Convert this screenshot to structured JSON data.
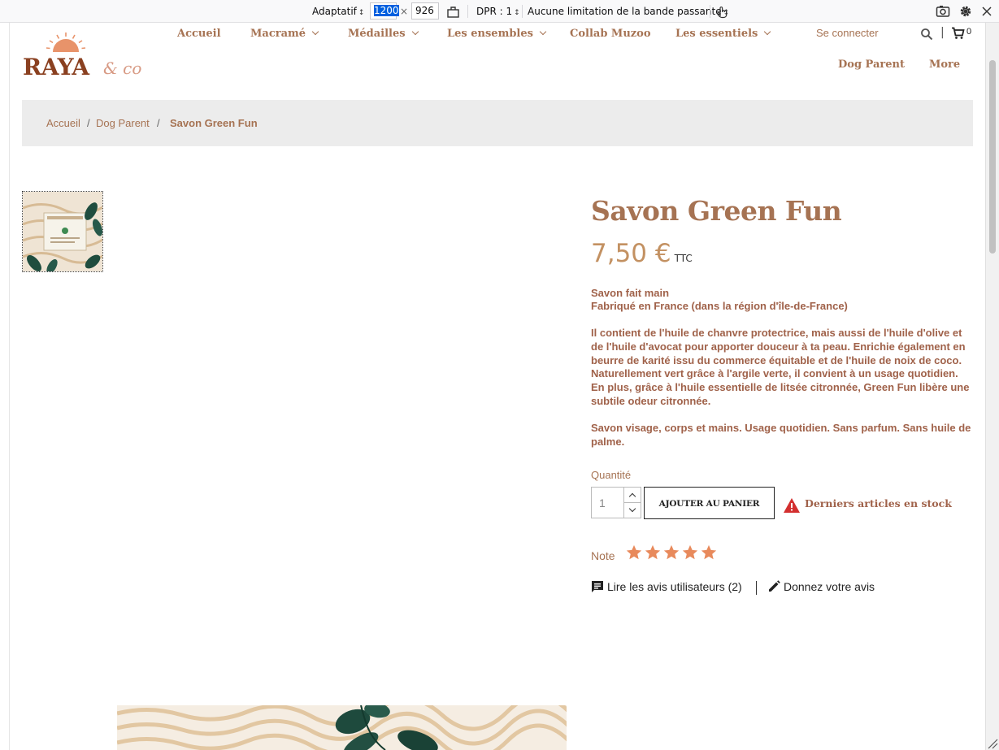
{
  "devtools": {
    "device": "Adaptatif",
    "width": "1200",
    "times": "×",
    "height": "926",
    "dpr": "DPR : 1",
    "throttling": "Aucune limitation de la bande passante"
  },
  "site": {
    "logo_main": "RAYA",
    "logo_script": "& co",
    "nav": [
      "Accueil",
      "Macramé",
      "Médailles",
      "Les ensembles",
      "Collab Muzoo",
      "Les essentiels",
      "Dog Parent",
      "More"
    ],
    "signin": "Se connecter",
    "header_pipe": "|",
    "cart_count": "0"
  },
  "breadcrumb": {
    "items": [
      "Accueil",
      "Dog Parent",
      "Savon Green Fun"
    ],
    "separator": "/"
  },
  "product": {
    "title": "Savon Green Fun",
    "price": "7,50 €",
    "tax_label": "TTC",
    "desc_1": "Savon fait main",
    "desc_2": "Fabriqué en France (dans la région d'île-de-France)",
    "desc_3": "Il contient de l'huile de chanvre protectrice, mais aussi de l'huile d'olive et de l'huile d'avocat pour apporter douceur à ta peau. Enrichie également en beurre de karité issu du commerce équitable et de l'huile de noix de coco. Naturellement vert grâce à l'argile verte, il convient à un usage quotidien. En plus, grâce à l'huile essentielle de litsée citronnée, Green Fun libère une subtile odeur citronnée.",
    "desc_4": "Savon visage, corps et mains. Usage quotidien. Sans parfum. Sans huile de palme.",
    "qty_label": "Quantité",
    "qty_value": "1",
    "add_to_cart": "AJOUTER AU PANIER",
    "stock": "Derniers articles en stock",
    "note_label": "Note",
    "rating": 5,
    "rating_max": 5,
    "read_reviews": "Lire les avis utilisateurs (2)",
    "write_review": "Donnez votre avis"
  },
  "colors": {
    "brand": "#a67353",
    "price": "#c39162",
    "star": "#e88a5c",
    "warning": "#d32f2f"
  }
}
